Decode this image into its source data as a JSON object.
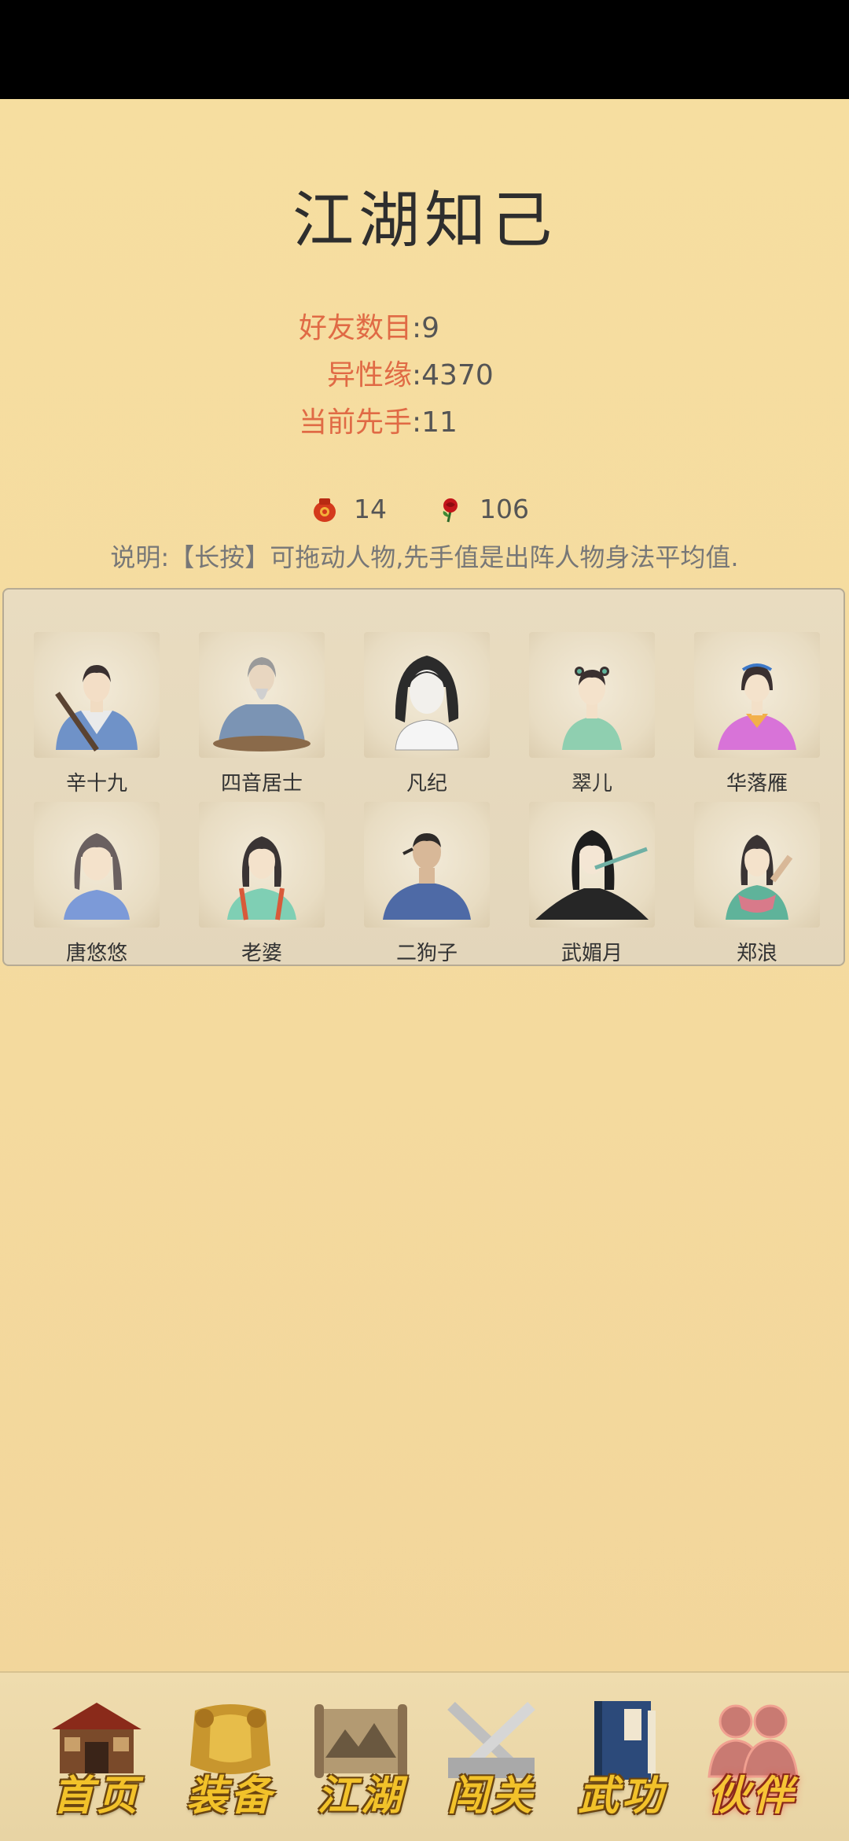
{
  "page": {
    "title": "江湖知己"
  },
  "stats": [
    {
      "label": "好友数目",
      "value": ":9"
    },
    {
      "label": "异性缘",
      "value": ":4370"
    },
    {
      "label": "当前先手",
      "value": ":11"
    }
  ],
  "currency": {
    "wine": {
      "icon": "wine-jar-icon",
      "value": "14"
    },
    "rose": {
      "icon": "rose-icon",
      "value": "106"
    }
  },
  "note": "说明:【长按】可拖动人物,先手值是出阵人物身法平均值.",
  "characters": [
    {
      "name": "辛十九"
    },
    {
      "name": "四音居士"
    },
    {
      "name": "凡纪"
    },
    {
      "name": "翠儿"
    },
    {
      "name": "华落雁"
    },
    {
      "name": "唐悠悠"
    },
    {
      "name": "老婆"
    },
    {
      "name": "二狗子"
    },
    {
      "name": "武媚月"
    },
    {
      "name": "郑浪"
    }
  ],
  "nav": [
    {
      "label": "首页",
      "icon": "house-icon",
      "active": false
    },
    {
      "label": "装备",
      "icon": "armor-icon",
      "active": false
    },
    {
      "label": "江湖",
      "icon": "scroll-map-icon",
      "active": false
    },
    {
      "label": "闯关",
      "icon": "crossed-swords-icon",
      "active": false
    },
    {
      "label": "武功",
      "icon": "book-icon",
      "active": false
    },
    {
      "label": "伙伴",
      "icon": "partners-icon",
      "active": true
    }
  ]
}
